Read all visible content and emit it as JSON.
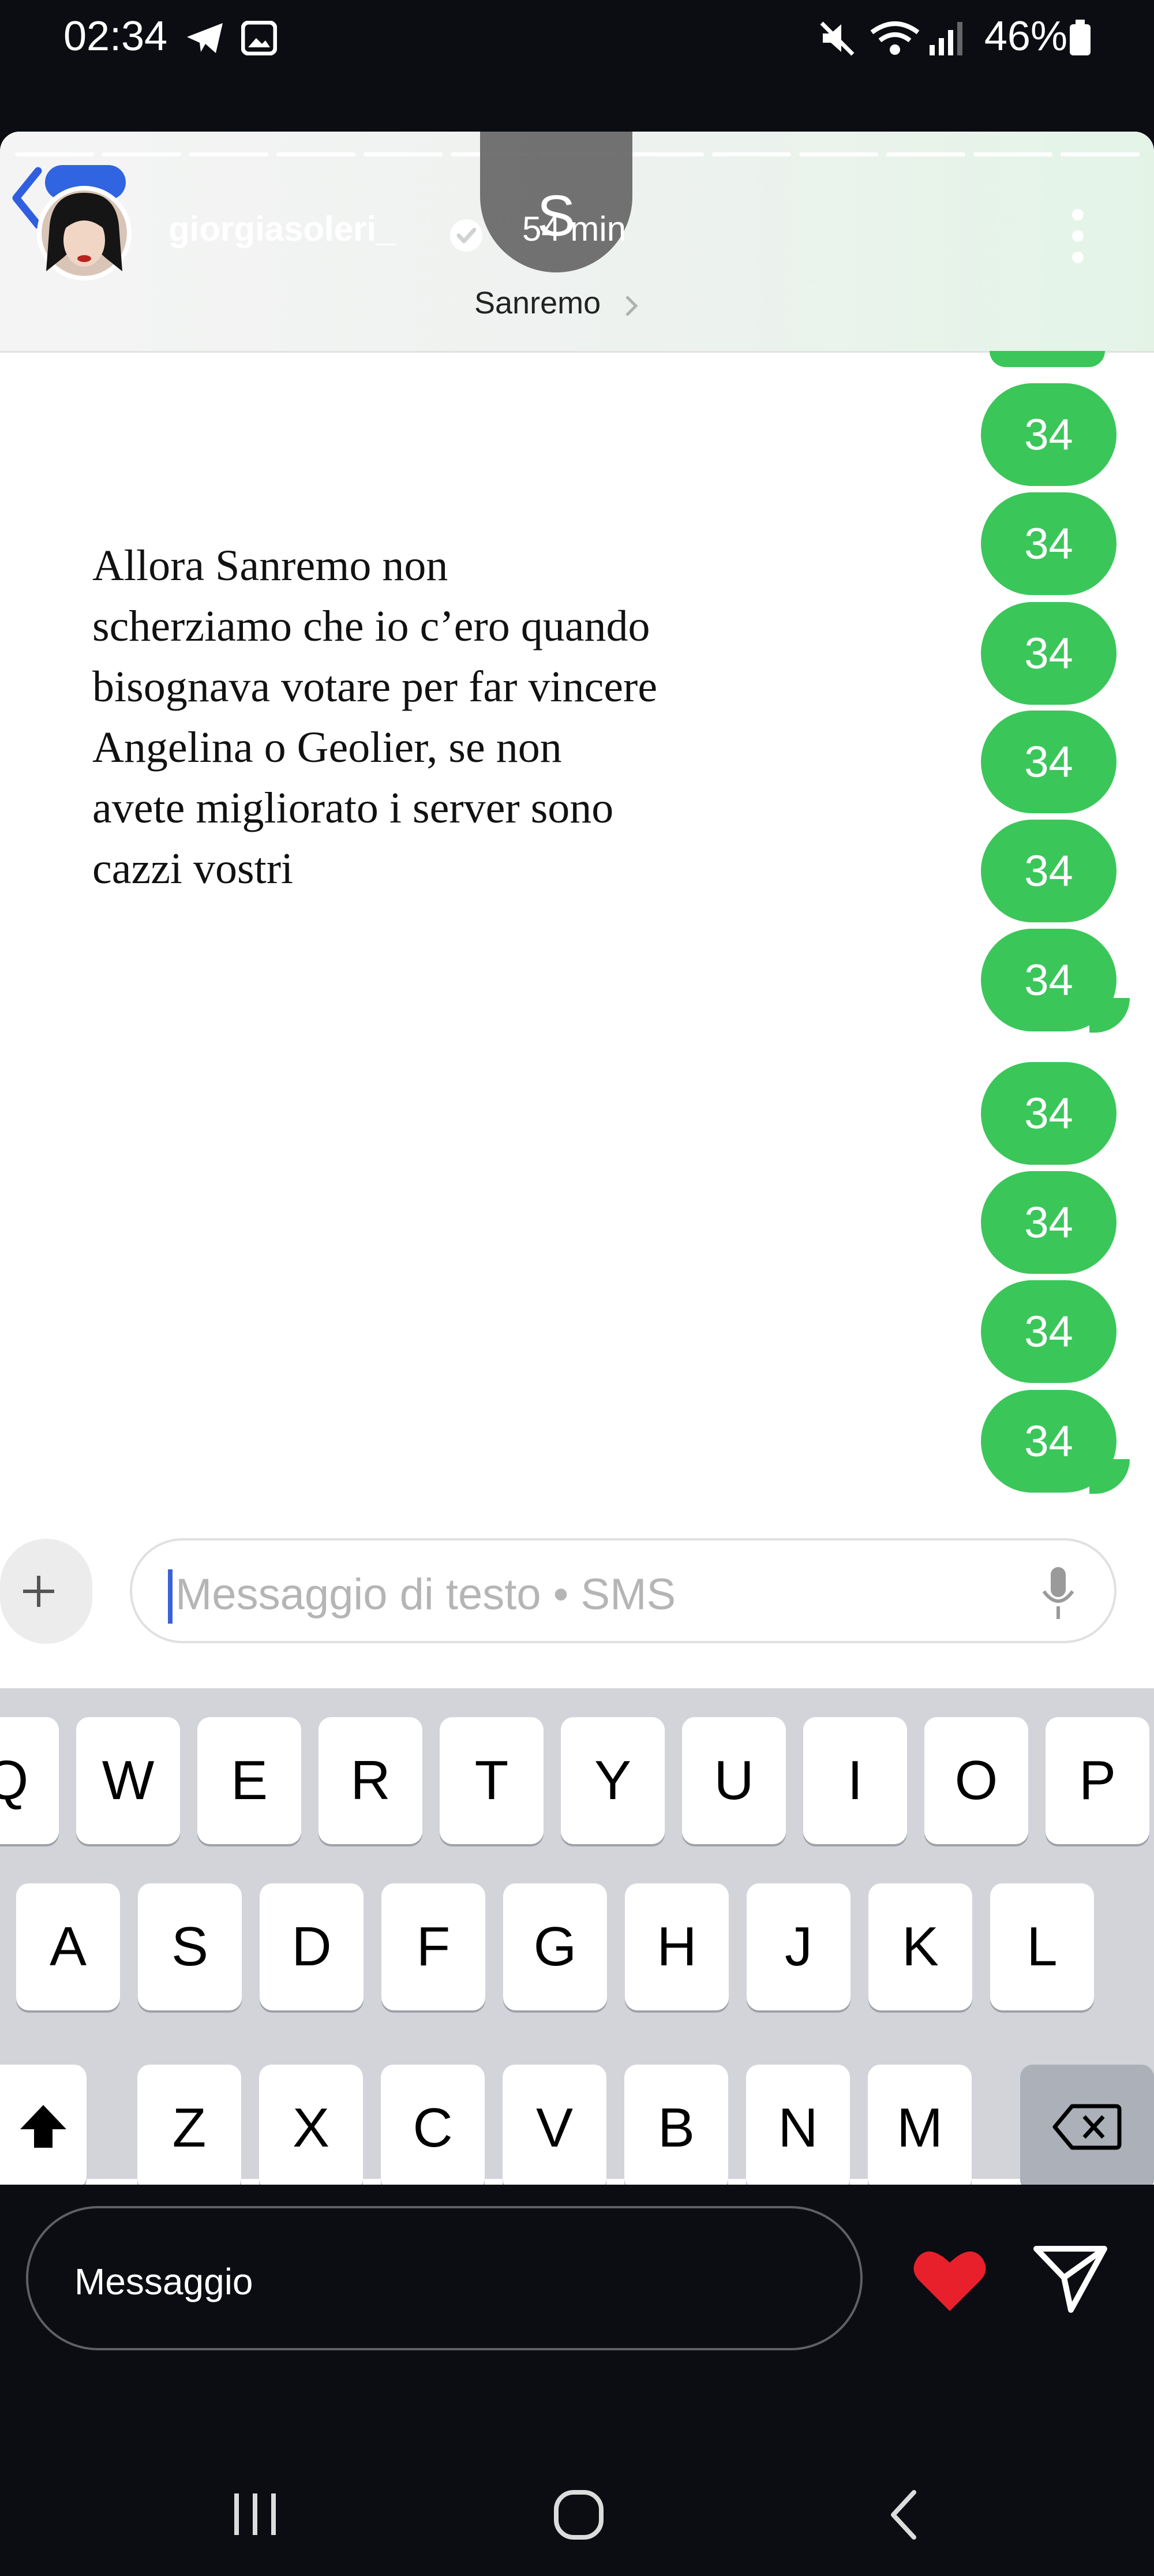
{
  "status_bar": {
    "time": "02:34",
    "battery": "46%",
    "icons": [
      "telegram-icon",
      "gallery-icon",
      "mute-icon",
      "wifi-icon",
      "signal-icon",
      "battery-icon"
    ]
  },
  "story": {
    "username": "giorgiasoleri_",
    "time_ago": "54 min",
    "music": "Sanremo",
    "overlay_letter": "S",
    "progress_segments": 13,
    "caption": "Allora Sanremo non\nscherziamo che io c’ero quando\nbisognava votare per far vincere\nAngelina o Geolier, se non\navete migliorato i server sono\ncazzi vostri",
    "bubbles": [
      "34",
      "34",
      "34",
      "34",
      "34",
      "34",
      "34",
      "34",
      "34",
      "34"
    ],
    "sms_placeholder": "Messaggio di testo • SMS",
    "keyboard": {
      "row1": [
        "Q",
        "W",
        "E",
        "R",
        "T",
        "Y",
        "U",
        "I",
        "O",
        "P"
      ],
      "row2": [
        "A",
        "S",
        "D",
        "F",
        "G",
        "H",
        "J",
        "K",
        "L"
      ],
      "row3": [
        "Z",
        "X",
        "C",
        "V",
        "B",
        "N",
        "M"
      ]
    }
  },
  "reply": {
    "placeholder": "Messaggio"
  },
  "colors": {
    "bubble": "#3bc65a",
    "heart": "#e8202c",
    "cursor": "#3a62d8"
  }
}
